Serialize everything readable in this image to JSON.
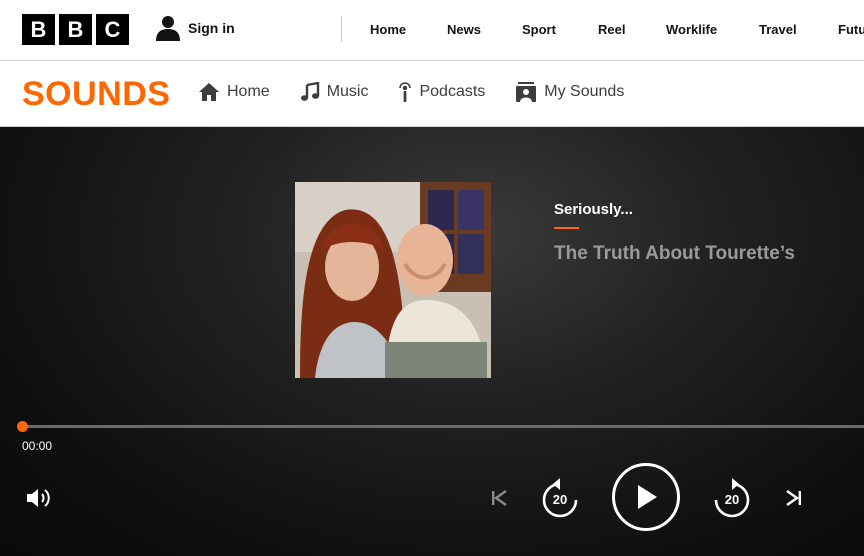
{
  "bbc": {
    "logo_letters": [
      "B",
      "B",
      "C"
    ],
    "signin_label": "Sign in",
    "nav": [
      "Home",
      "News",
      "Sport",
      "Reel",
      "Worklife",
      "Travel",
      "Futu"
    ]
  },
  "sounds": {
    "logo": "SOUNDS",
    "brand_color": "#ff6600",
    "nav": [
      {
        "label": "Home",
        "icon": "home-icon"
      },
      {
        "label": "Music",
        "icon": "music-note-icon"
      },
      {
        "label": "Podcasts",
        "icon": "podcast-icon"
      },
      {
        "label": "My Sounds",
        "icon": "my-sounds-icon"
      }
    ]
  },
  "player": {
    "brand": "Seriously...",
    "episode_title": "The Truth About Tourette’s",
    "elapsed": "00:00",
    "progress": 0,
    "rewind_seconds": "20",
    "forward_seconds": "20",
    "icons": [
      "volume-icon",
      "previous-icon",
      "rewind-20-icon",
      "play-icon",
      "forward-20-icon",
      "next-icon"
    ]
  }
}
